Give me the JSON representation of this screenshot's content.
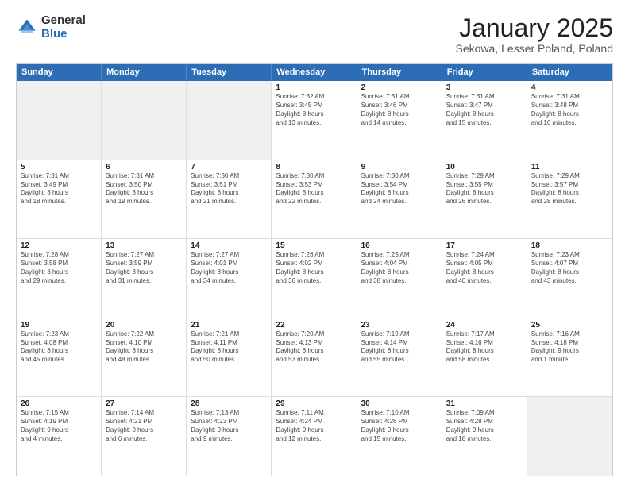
{
  "logo": {
    "general": "General",
    "blue": "Blue"
  },
  "header": {
    "title": "January 2025",
    "subtitle": "Sekowa, Lesser Poland, Poland"
  },
  "weekdays": [
    "Sunday",
    "Monday",
    "Tuesday",
    "Wednesday",
    "Thursday",
    "Friday",
    "Saturday"
  ],
  "rows": [
    [
      {
        "day": "",
        "info": "",
        "shaded": true
      },
      {
        "day": "",
        "info": "",
        "shaded": true
      },
      {
        "day": "",
        "info": "",
        "shaded": true
      },
      {
        "day": "1",
        "info": "Sunrise: 7:32 AM\nSunset: 3:45 PM\nDaylight: 8 hours\nand 13 minutes."
      },
      {
        "day": "2",
        "info": "Sunrise: 7:31 AM\nSunset: 3:46 PM\nDaylight: 8 hours\nand 14 minutes."
      },
      {
        "day": "3",
        "info": "Sunrise: 7:31 AM\nSunset: 3:47 PM\nDaylight: 8 hours\nand 15 minutes."
      },
      {
        "day": "4",
        "info": "Sunrise: 7:31 AM\nSunset: 3:48 PM\nDaylight: 8 hours\nand 16 minutes."
      }
    ],
    [
      {
        "day": "5",
        "info": "Sunrise: 7:31 AM\nSunset: 3:49 PM\nDaylight: 8 hours\nand 18 minutes."
      },
      {
        "day": "6",
        "info": "Sunrise: 7:31 AM\nSunset: 3:50 PM\nDaylight: 8 hours\nand 19 minutes."
      },
      {
        "day": "7",
        "info": "Sunrise: 7:30 AM\nSunset: 3:51 PM\nDaylight: 8 hours\nand 21 minutes."
      },
      {
        "day": "8",
        "info": "Sunrise: 7:30 AM\nSunset: 3:53 PM\nDaylight: 8 hours\nand 22 minutes."
      },
      {
        "day": "9",
        "info": "Sunrise: 7:30 AM\nSunset: 3:54 PM\nDaylight: 8 hours\nand 24 minutes."
      },
      {
        "day": "10",
        "info": "Sunrise: 7:29 AM\nSunset: 3:55 PM\nDaylight: 8 hours\nand 26 minutes."
      },
      {
        "day": "11",
        "info": "Sunrise: 7:29 AM\nSunset: 3:57 PM\nDaylight: 8 hours\nand 28 minutes."
      }
    ],
    [
      {
        "day": "12",
        "info": "Sunrise: 7:28 AM\nSunset: 3:58 PM\nDaylight: 8 hours\nand 29 minutes."
      },
      {
        "day": "13",
        "info": "Sunrise: 7:27 AM\nSunset: 3:59 PM\nDaylight: 8 hours\nand 31 minutes."
      },
      {
        "day": "14",
        "info": "Sunrise: 7:27 AM\nSunset: 4:01 PM\nDaylight: 8 hours\nand 34 minutes."
      },
      {
        "day": "15",
        "info": "Sunrise: 7:26 AM\nSunset: 4:02 PM\nDaylight: 8 hours\nand 36 minutes."
      },
      {
        "day": "16",
        "info": "Sunrise: 7:25 AM\nSunset: 4:04 PM\nDaylight: 8 hours\nand 38 minutes."
      },
      {
        "day": "17",
        "info": "Sunrise: 7:24 AM\nSunset: 4:05 PM\nDaylight: 8 hours\nand 40 minutes."
      },
      {
        "day": "18",
        "info": "Sunrise: 7:23 AM\nSunset: 4:07 PM\nDaylight: 8 hours\nand 43 minutes."
      }
    ],
    [
      {
        "day": "19",
        "info": "Sunrise: 7:23 AM\nSunset: 4:08 PM\nDaylight: 8 hours\nand 45 minutes."
      },
      {
        "day": "20",
        "info": "Sunrise: 7:22 AM\nSunset: 4:10 PM\nDaylight: 8 hours\nand 48 minutes."
      },
      {
        "day": "21",
        "info": "Sunrise: 7:21 AM\nSunset: 4:11 PM\nDaylight: 8 hours\nand 50 minutes."
      },
      {
        "day": "22",
        "info": "Sunrise: 7:20 AM\nSunset: 4:13 PM\nDaylight: 8 hours\nand 53 minutes."
      },
      {
        "day": "23",
        "info": "Sunrise: 7:19 AM\nSunset: 4:14 PM\nDaylight: 8 hours\nand 55 minutes."
      },
      {
        "day": "24",
        "info": "Sunrise: 7:17 AM\nSunset: 4:16 PM\nDaylight: 8 hours\nand 58 minutes."
      },
      {
        "day": "25",
        "info": "Sunrise: 7:16 AM\nSunset: 4:18 PM\nDaylight: 9 hours\nand 1 minute."
      }
    ],
    [
      {
        "day": "26",
        "info": "Sunrise: 7:15 AM\nSunset: 4:19 PM\nDaylight: 9 hours\nand 4 minutes."
      },
      {
        "day": "27",
        "info": "Sunrise: 7:14 AM\nSunset: 4:21 PM\nDaylight: 9 hours\nand 6 minutes."
      },
      {
        "day": "28",
        "info": "Sunrise: 7:13 AM\nSunset: 4:23 PM\nDaylight: 9 hours\nand 9 minutes."
      },
      {
        "day": "29",
        "info": "Sunrise: 7:11 AM\nSunset: 4:24 PM\nDaylight: 9 hours\nand 12 minutes."
      },
      {
        "day": "30",
        "info": "Sunrise: 7:10 AM\nSunset: 4:26 PM\nDaylight: 9 hours\nand 15 minutes."
      },
      {
        "day": "31",
        "info": "Sunrise: 7:09 AM\nSunset: 4:28 PM\nDaylight: 9 hours\nand 18 minutes."
      },
      {
        "day": "",
        "info": "",
        "shaded": true
      }
    ]
  ]
}
